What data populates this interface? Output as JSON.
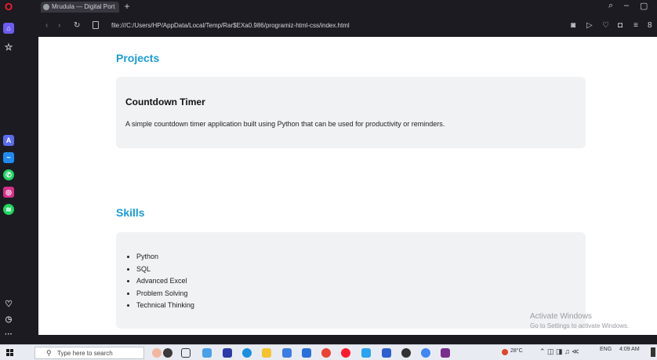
{
  "browser": {
    "tab_title": "Mrudula — Digital Port",
    "url": "file:///C:/Users/HP/AppData/Local/Temp/Rar$EXa0.986/programiz-html-css/index.html"
  },
  "page": {
    "projects_heading": "Projects",
    "projects": [
      {
        "title": "Countdown Timer",
        "description": "A simple countdown timer application built using Python that can be used for productivity or reminders."
      }
    ],
    "skills_heading": "Skills",
    "skills": [
      "Python",
      "SQL",
      "Advanced Excel",
      "Problem Solving",
      "Technical Thinking"
    ]
  },
  "watermark": {
    "line1": "Activate Windows",
    "line2": "Go to Settings to activate Windows."
  },
  "taskbar": {
    "search_placeholder": "Type here to search",
    "temperature": "28°C",
    "language": "ENG",
    "time": "4:09 AM"
  },
  "colors": {
    "accent": "#1a9cd8",
    "card_bg": "#f1f2f3",
    "browser_chrome": "#1c1b22"
  }
}
